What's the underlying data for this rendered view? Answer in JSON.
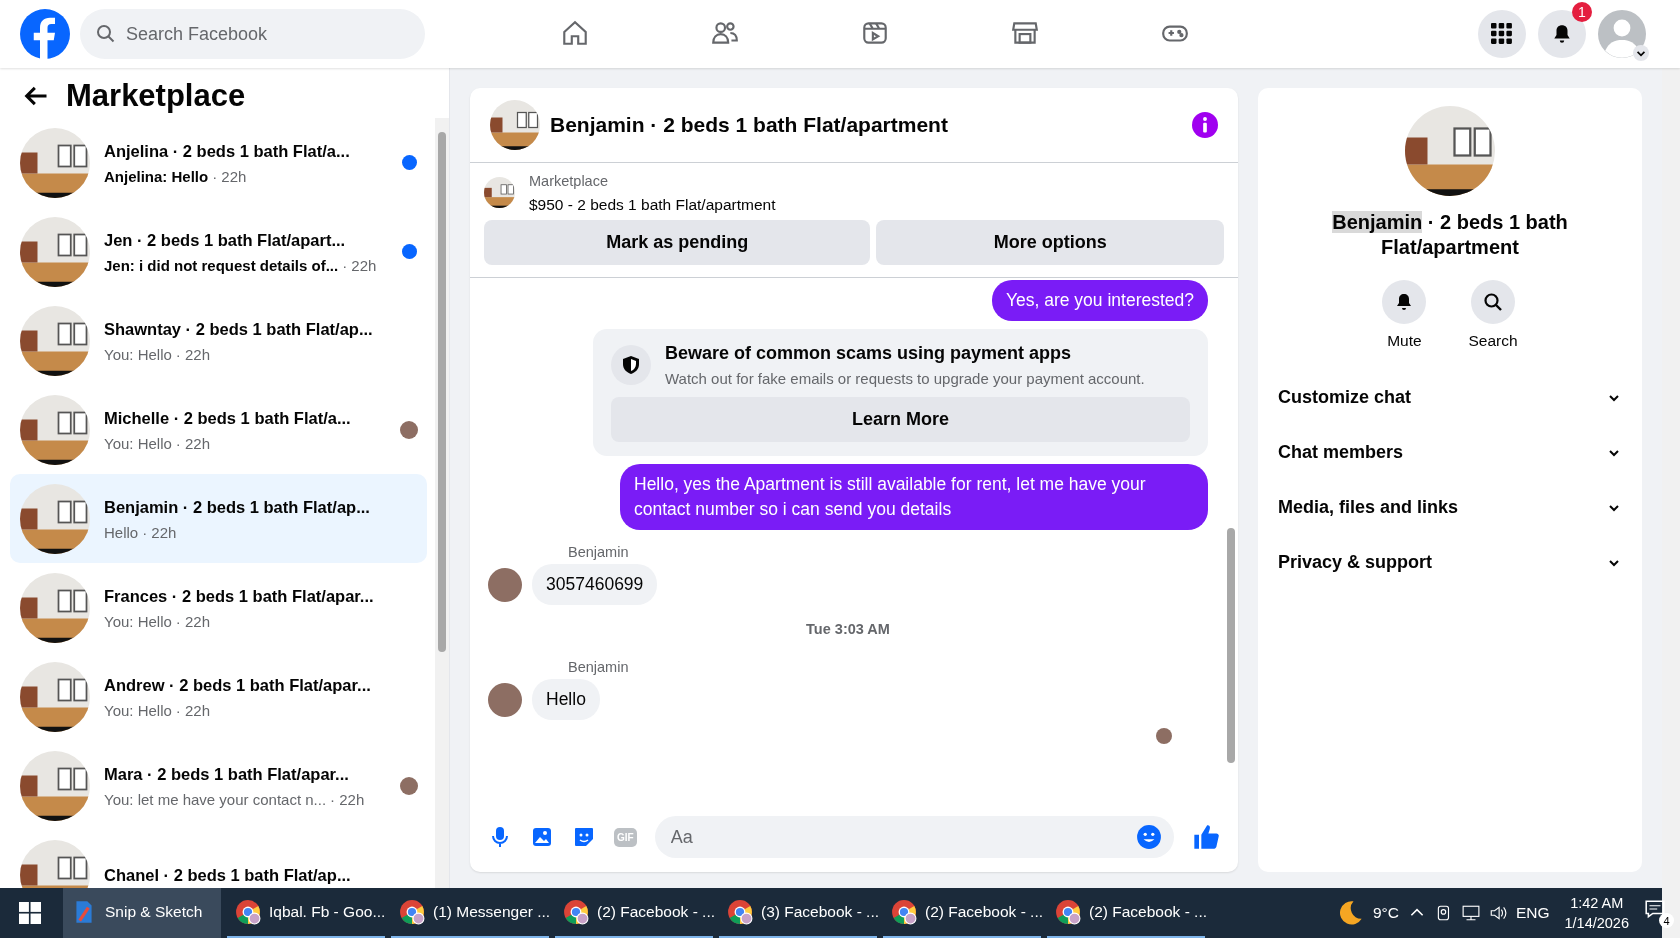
{
  "top_bar": {
    "search": {
      "placeholder": "Search Facebook"
    },
    "nav": [
      {
        "kind": "home",
        "selected": false
      },
      {
        "kind": "friends",
        "selected": false
      },
      {
        "kind": "watch",
        "selected": false
      },
      {
        "kind": "marketplace",
        "selected": false
      },
      {
        "kind": "gaming",
        "selected": false
      }
    ],
    "notification_badge": "1"
  },
  "sidebar": {
    "title": "Marketplace",
    "conversations": [
      {
        "title": "Anjelina · 2 beds 1 bath Flat/a...",
        "preview": "Anjelina: Hello",
        "time": "· 22h",
        "unread": true,
        "selected": false,
        "seen": false
      },
      {
        "title": "Jen · 2 beds 1 bath Flat/apart...",
        "preview": "Jen: i did not request details of...",
        "time": "· 22h",
        "unread": true,
        "selected": false,
        "seen": false
      },
      {
        "title": "Shawntay · 2 beds 1 bath Flat/ap...",
        "preview": "You: Hello",
        "time": "· 22h",
        "unread": false,
        "selected": false,
        "seen": false
      },
      {
        "title": "Michelle · 2 beds 1 bath Flat/a...",
        "preview": "You: Hello",
        "time": "· 22h",
        "unread": false,
        "selected": false,
        "seen": true
      },
      {
        "title": "Benjamin · 2 beds 1 bath Flat/ap...",
        "preview": "Hello",
        "time": "· 22h",
        "unread": false,
        "selected": true,
        "seen": false
      },
      {
        "title": "Frances · 2 beds 1 bath Flat/apar...",
        "preview": "You: Hello",
        "time": "· 22h",
        "unread": false,
        "selected": false,
        "seen": false
      },
      {
        "title": "Andrew · 2 beds 1 bath Flat/apar...",
        "preview": "You: Hello",
        "time": "· 22h",
        "unread": false,
        "selected": false,
        "seen": false
      },
      {
        "title": "Mara · 2 beds 1 bath Flat/apar...",
        "preview": "You: let me have your contact n...",
        "time": "· 22h",
        "unread": false,
        "selected": false,
        "seen": true
      },
      {
        "title": "Chanel · 2 beds 1 bath Flat/ap...",
        "unread": false,
        "selected": false,
        "seen": false
      }
    ]
  },
  "chat": {
    "title": "Benjamin · 2 beds 1 bath Flat/apartment",
    "listing": {
      "label": "Marketplace",
      "price_title": "$950 - 2 beds 1 bath Flat/apartment"
    },
    "actions": [
      "Mark as pending",
      "More options"
    ],
    "messages": [
      {
        "kind": "outgoing",
        "text": "Yes, are you interested?"
      },
      {
        "kind": "notice",
        "title": "Beware of common scams using payment apps",
        "text": "Watch out for fake emails or requests to upgrade your payment account.",
        "button": "Learn More"
      },
      {
        "kind": "outgoing",
        "text": "Hello, yes the Apartment is still available for rent, let me have your contact number so i can send you details"
      },
      {
        "kind": "incoming",
        "sender": "Benjamin",
        "text": "3057460699"
      },
      {
        "kind": "timestamp",
        "text": "Tue 3:03 AM"
      },
      {
        "kind": "incoming",
        "sender": "Benjamin",
        "text": "Hello"
      },
      {
        "kind": "seen"
      }
    ],
    "composer": {
      "placeholder": "Aa",
      "gif_label": "GIF"
    }
  },
  "details": {
    "name": "Benjamin",
    "name_highlighted": true,
    "subtitle": "· 2 beds 1 bath Flat/apartment",
    "actions": [
      {
        "kind": "mute",
        "label": "Mute"
      },
      {
        "kind": "search",
        "label": "Search"
      }
    ],
    "sections": [
      {
        "label": "Customize chat",
        "expanded": false
      },
      {
        "label": "Chat members",
        "expanded": false
      },
      {
        "label": "Media, files and links",
        "expanded": false
      },
      {
        "label": "Privacy & support",
        "expanded": false
      }
    ]
  },
  "taskbar": {
    "apps": [
      {
        "kind": "snip",
        "label": "Snip & Sketch",
        "selected": true
      },
      {
        "kind": "chrome",
        "label": "Iqbal. Fb - Goo...",
        "selected": false
      },
      {
        "kind": "chrome",
        "label": "(1) Messenger ...",
        "selected": false
      },
      {
        "kind": "chrome",
        "label": "(2) Facebook - ...",
        "selected": false
      },
      {
        "kind": "chrome",
        "label": "(3) Facebook - ...",
        "selected": false
      },
      {
        "kind": "chrome",
        "label": "(2) Facebook - ...",
        "selected": false
      },
      {
        "kind": "chrome",
        "label": "(2) Facebook - ...",
        "selected": false
      }
    ],
    "temperature": "9°C",
    "language": "ENG",
    "time": "1:42 AM",
    "date": "1/14/2026",
    "notifications": "4"
  }
}
